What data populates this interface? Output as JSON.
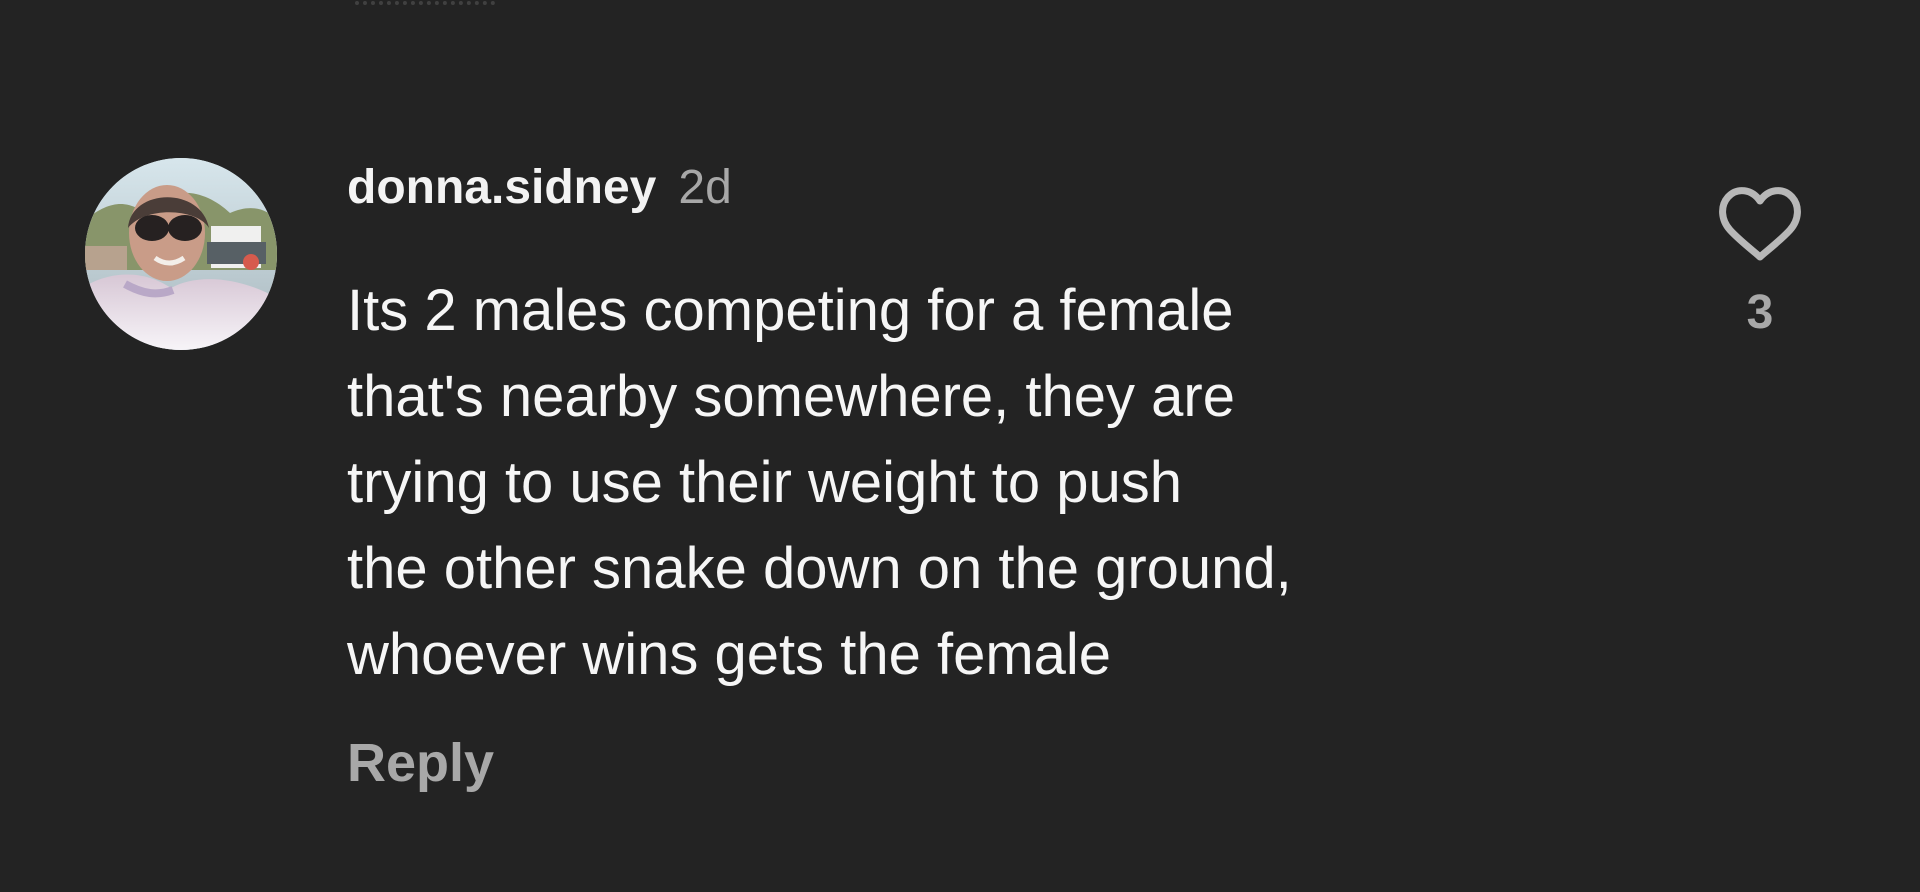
{
  "comment": {
    "username": "donna.sidney",
    "timestamp": "2d",
    "text": "Its 2 males competing for a female\nthat's nearby somewhere,  they are\ntrying to use their weight to push\nthe other snake down on the ground,\nwhoever wins gets the female",
    "reply_label": "Reply",
    "like_count": "3",
    "avatar_icon": "profile-photo-icon",
    "like_icon": "heart-outline-icon"
  },
  "theme": {
    "background": "#232323",
    "primary_text": "#f2f2f2",
    "secondary_text": "#a8a8a8",
    "like_icon_color": "#b8b8b8"
  }
}
